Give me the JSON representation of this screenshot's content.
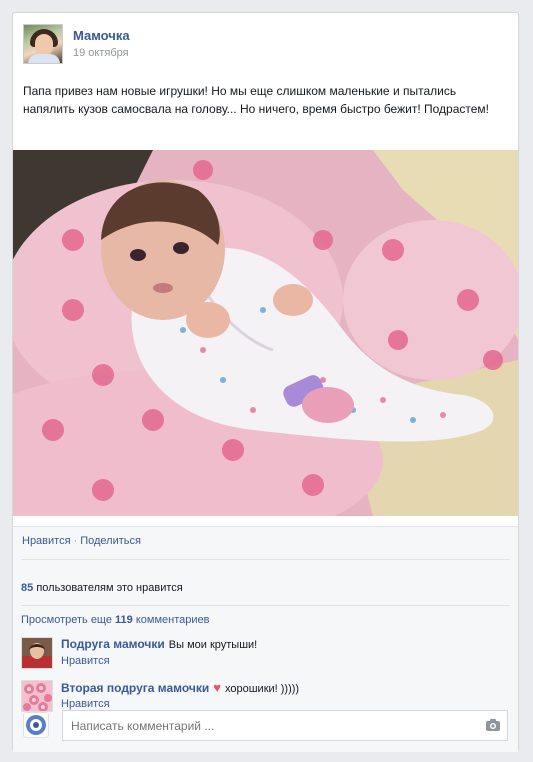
{
  "post": {
    "author": "Мамочка",
    "date": "19 октября",
    "text": "Папа привез нам новые игрушки! Но мы еще слишком маленькие и пытались напялить кузов самосвала на голову... Но ничего, время быстро бежит! Подрастем!",
    "photo_icon": "baby-photo"
  },
  "actions": {
    "like": "Нравится",
    "separator": "·",
    "share": "Поделиться"
  },
  "likes": {
    "count": "85",
    "text": "пользователям это нравится"
  },
  "more_comments": {
    "prefix": "Просмотреть еще",
    "count": "119",
    "suffix": "комментариев"
  },
  "comments": [
    {
      "author": "Подруга мамочки",
      "text": "Вы мои крутыши!",
      "like": "Нравится"
    },
    {
      "author": "Вторая подруга мамочки",
      "emoji": "♥",
      "text": "хорошики! )))))",
      "like": "Нравится"
    }
  ],
  "composer": {
    "placeholder": "Написать комментарий ...",
    "icon": "camera-icon"
  },
  "colors": {
    "link": "#3b5998",
    "background": "#e9ebee"
  }
}
